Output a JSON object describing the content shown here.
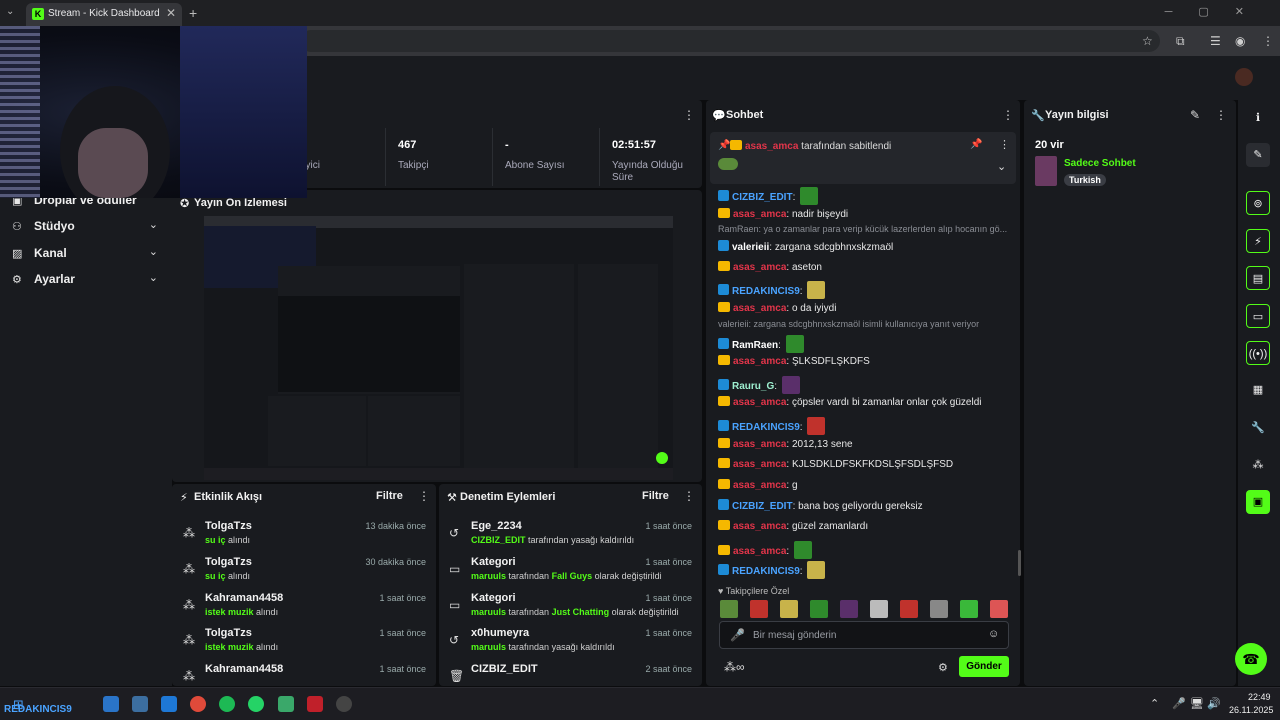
{
  "browser": {
    "tab_title": "Stream - Kick Dashboard",
    "tab_favicon": "K",
    "new_tab": "+",
    "close_tab": "✕"
  },
  "sidebar": {
    "items": [
      {
        "label": "Droplar ve ödüller",
        "icon": "gift-icon"
      },
      {
        "label": "Stüdyo",
        "icon": "studio-icon"
      },
      {
        "label": "Kanal",
        "icon": "channel-icon"
      },
      {
        "label": "Ayarlar",
        "icon": "settings-icon"
      }
    ]
  },
  "stats": [
    {
      "value": "",
      "label": "İzleyici"
    },
    {
      "value": "467",
      "label": "Takipçi"
    },
    {
      "value": "-",
      "label": "Abone Sayısı"
    },
    {
      "value": "02:51:57",
      "label": "Yayında Olduğu Süre"
    }
  ],
  "preview": {
    "title": "Yayın Ön İzlemesi"
  },
  "activity": {
    "title": "Etkinlik Akışı",
    "filter": "Filtre",
    "items": [
      {
        "name": "TolgaTzs",
        "reward": "su iç",
        "suffix": "alındı",
        "time": "13 dakika önce"
      },
      {
        "name": "TolgaTzs",
        "reward": "su iç",
        "suffix": "alındı",
        "time": "30 dakika önce"
      },
      {
        "name": "Kahraman4458",
        "reward": "istek muzik",
        "suffix": "alındı",
        "time": "1 saat önce"
      },
      {
        "name": "TolgaTzs",
        "reward": "istek muzik",
        "suffix": "alındı",
        "time": "1 saat önce"
      },
      {
        "name": "Kahraman4458",
        "reward": "",
        "suffix": "",
        "time": "1 saat önce"
      }
    ]
  },
  "moderation": {
    "title": "Denetim Eylemleri",
    "filter": "Filtre",
    "items": [
      {
        "name": "Ege_2234",
        "actor": "CIZBIZ_EDIT",
        "text": "tarafından yasağı kaldırıldı",
        "time": "1 saat önce"
      },
      {
        "name": "Kategori",
        "actor": "maruuls",
        "text": "tarafından",
        "target": "Fall Guys",
        "text2": "olarak değiştirildi",
        "time": "1 saat önce"
      },
      {
        "name": "Kategori",
        "actor": "maruuls",
        "text": "tarafından",
        "target": "Just Chatting",
        "text2": "olarak değiştirildi",
        "time": "1 saat önce"
      },
      {
        "name": "x0humeyra",
        "actor": "maruuls",
        "text": "tarafından yasağı kaldırıldı",
        "time": "1 saat önce"
      },
      {
        "name": "CIZBIZ_EDIT",
        "actor": "",
        "text": "",
        "time": "2 saat önce"
      }
    ]
  },
  "chat": {
    "title": "Sohbet",
    "pinned_user": "asas_amca",
    "pinned_text": "tarafından sabitlendi",
    "lines": [
      {
        "user": "CIZBIZ_EDIT",
        "color": "blue",
        "text": "",
        "emote": "g"
      },
      {
        "user": "asas_amca",
        "color": "red",
        "text": "nadir bişeydi"
      },
      {
        "reply": "RamRaen: ya o zamanlar para verip kücük lazerlerden alıp hocanın gö..."
      },
      {
        "user": "valerieii",
        "color": "white",
        "text": "zargana sdcgbhnxskzmaöl"
      },
      {
        "user": "asas_amca",
        "color": "red",
        "text": "aseton"
      },
      {
        "user": "REDAKINCIS9",
        "color": "blue",
        "text": "",
        "emote": "y"
      },
      {
        "user": "asas_amca",
        "color": "red",
        "text": "o da iyiydi"
      },
      {
        "reply": "valerieii: zargana sdcgbhnxskzmaöl isimli kullanıcıya yanıt veriyor"
      },
      {
        "user": "RamRaen",
        "color": "white",
        "text": "",
        "emote": "g"
      },
      {
        "user": "asas_amca",
        "color": "red",
        "text": "ŞLKSDFLŞKDFS"
      },
      {
        "user": "Rauru_G",
        "color": "teal",
        "text": "",
        "emote": "p"
      },
      {
        "user": "asas_amca",
        "color": "red",
        "text": "çöpsler vardı bi zamanlar onlar çok güzeldi"
      },
      {
        "user": "REDAKINCIS9",
        "color": "blue",
        "text": "",
        "emote": "r"
      },
      {
        "user": "asas_amca",
        "color": "red",
        "text": "2012,13 sene"
      },
      {
        "user": "asas_amca",
        "color": "red",
        "text": "KJLSDKLDFSKFKDSLŞFSDLŞFSD"
      },
      {
        "user": "asas_amca",
        "color": "red",
        "text": "g"
      },
      {
        "user": "CIZBIZ_EDIT",
        "color": "blue",
        "text": "bana boş geliyordu gereksiz"
      },
      {
        "user": "asas_amca",
        "color": "red",
        "text": "güzel zamanlardı"
      },
      {
        "user": "asas_amca",
        "color": "red",
        "text": "",
        "emote": "g"
      },
      {
        "user": "REDAKINCIS9",
        "color": "blue",
        "text": "",
        "emote": "y"
      }
    ],
    "followers_only": "Takipçilere Özel",
    "input_placeholder": "Bir mesaj gönderin",
    "send": "Gönder"
  },
  "stream_info": {
    "title": "Yayın bilgisi",
    "stream_title": "20 vir",
    "category": "Sadece Sohbet",
    "tag": "Turkish"
  },
  "taskbar": {
    "user_label": "REDAKINCIS9",
    "time": "22:49",
    "date": "26.11.2025"
  }
}
